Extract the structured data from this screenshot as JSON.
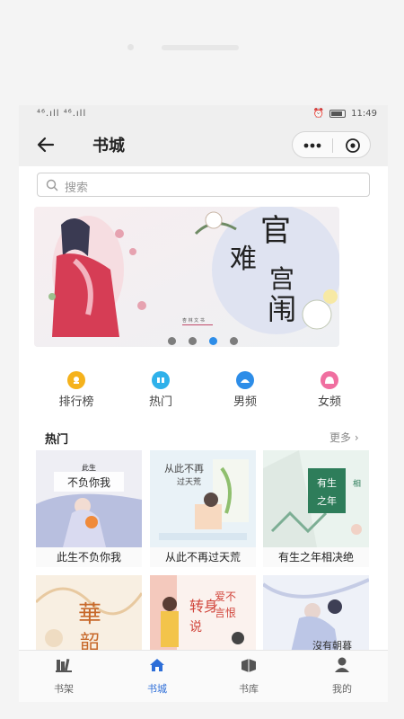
{
  "status_bar": {
    "signal_left": "⁴⁶.ıll ⁴⁶.ıll",
    "time": "11:49",
    "icons": [
      "signal-icon",
      "wifi-icon",
      "alarm-icon",
      "battery-icon"
    ]
  },
  "header": {
    "title": "书城",
    "back_icon": "back-arrow-icon",
    "capsule_icons": [
      "more-dots-icon",
      "close-circle-icon"
    ]
  },
  "search": {
    "placeholder": "搜索",
    "icon": "search-icon"
  },
  "banner": {
    "slides": 4,
    "active_index": 2,
    "cover_title": "官难宫闱",
    "cover_small": "杏林文书"
  },
  "categories": [
    {
      "label": "排行榜",
      "color": "#f5b21c",
      "icon": "ranking-icon"
    },
    {
      "label": "热门",
      "color": "#2fb1ea",
      "icon": "hot-icon"
    },
    {
      "label": "男频",
      "color": "#2d8de8",
      "icon": "male-icon"
    },
    {
      "label": "女频",
      "color": "#f06fa0",
      "icon": "female-icon"
    }
  ],
  "section": {
    "title": "热门",
    "more": "更多 ›"
  },
  "books": [
    {
      "name": "此生不负你我",
      "cover_text": "此生 不负你我"
    },
    {
      "name": "从此不再过天荒",
      "cover_text": "从此不再 过天荒"
    },
    {
      "name": "有生之年相决绝",
      "cover_text": "有生之年 相决绝"
    },
    {
      "name": "",
      "cover_text": "華韶"
    },
    {
      "name": "",
      "cover_text": "转身说 爱不言恨"
    },
    {
      "name": "",
      "cover_text": "沒有朝暮"
    }
  ],
  "tabs": [
    {
      "label": "书架",
      "icon": "bookshelf-icon",
      "active": false
    },
    {
      "label": "书城",
      "icon": "home-icon",
      "active": true
    },
    {
      "label": "书库",
      "icon": "book-icon",
      "active": false
    },
    {
      "label": "我的",
      "icon": "user-icon",
      "active": false
    }
  ],
  "colors": {
    "accent": "#2d6ed8",
    "header_bg": "#efefef"
  }
}
